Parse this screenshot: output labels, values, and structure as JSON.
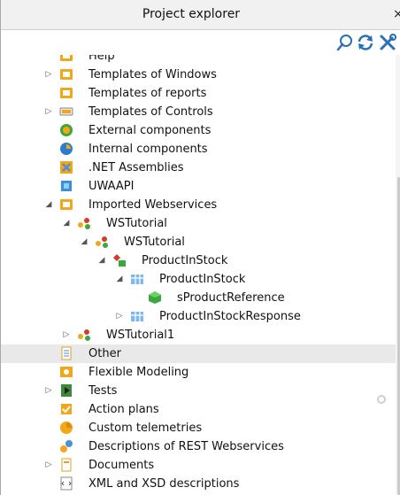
{
  "panel": {
    "title": "Project explorer",
    "close_glyph": "×"
  },
  "toolbar": {
    "search_icon": "search-icon",
    "refresh_icon": "refresh-icon",
    "settings_icon": "tools-icon"
  },
  "tree": [
    {
      "label": "Help",
      "depth": 0,
      "expander": "",
      "icon": "help-icon"
    },
    {
      "label": "Templates of Windows",
      "depth": 0,
      "expander": "collapsed",
      "icon": "window-template-icon"
    },
    {
      "label": "Templates of reports",
      "depth": 0,
      "expander": "",
      "icon": "report-template-icon"
    },
    {
      "label": "Templates of Controls",
      "depth": 0,
      "expander": "collapsed",
      "icon": "control-template-icon"
    },
    {
      "label": "External components",
      "depth": 0,
      "expander": "",
      "icon": "external-component-icon"
    },
    {
      "label": "Internal components",
      "depth": 0,
      "expander": "",
      "icon": "internal-component-icon"
    },
    {
      "label": ".NET Assemblies",
      "depth": 0,
      "expander": "",
      "icon": "dotnet-assembly-icon"
    },
    {
      "label": "UWAAPI",
      "depth": 0,
      "expander": "",
      "icon": "uwaapi-icon"
    },
    {
      "label": "Imported Webservices",
      "depth": 0,
      "expander": "expanded",
      "icon": "webservices-folder-icon"
    },
    {
      "label": "WSTutorial",
      "depth": 1,
      "expander": "expanded",
      "icon": "webservice-icon"
    },
    {
      "label": "WSTutorial",
      "depth": 2,
      "expander": "expanded",
      "icon": "webservice-icon"
    },
    {
      "label": "ProductInStock",
      "depth": 3,
      "expander": "expanded",
      "icon": "method-icon"
    },
    {
      "label": "ProductInStock",
      "depth": 4,
      "expander": "expanded",
      "icon": "structure-icon"
    },
    {
      "label": "sProductReference",
      "depth": 5,
      "expander": "",
      "icon": "member-icon"
    },
    {
      "label": "ProductInStockResponse",
      "depth": 4,
      "expander": "collapsed",
      "icon": "structure-icon"
    },
    {
      "label": "WSTutorial1",
      "depth": 1,
      "expander": "collapsed",
      "icon": "webservice-icon"
    },
    {
      "label": "Other",
      "depth": 0,
      "expander": "",
      "icon": "other-icon",
      "selected": true
    },
    {
      "label": "Flexible Modeling",
      "depth": 0,
      "expander": "",
      "icon": "flexible-modeling-icon"
    },
    {
      "label": "Tests",
      "depth": 0,
      "expander": "collapsed",
      "icon": "tests-icon"
    },
    {
      "label": "Action plans",
      "depth": 0,
      "expander": "",
      "icon": "action-plans-icon"
    },
    {
      "label": "Custom telemetries",
      "depth": 0,
      "expander": "",
      "icon": "telemetry-icon"
    },
    {
      "label": "Descriptions of REST Webservices",
      "depth": 0,
      "expander": "",
      "icon": "rest-webservice-icon"
    },
    {
      "label": "Documents",
      "depth": 0,
      "expander": "collapsed",
      "icon": "documents-icon"
    },
    {
      "label": "XML and XSD descriptions",
      "depth": 0,
      "expander": "",
      "icon": "xml-icon"
    }
  ],
  "colors": {
    "folder": "#f2a71b",
    "accent_blue": "#2a7fc8",
    "green": "#3aa83a",
    "red": "#d63a2a"
  }
}
